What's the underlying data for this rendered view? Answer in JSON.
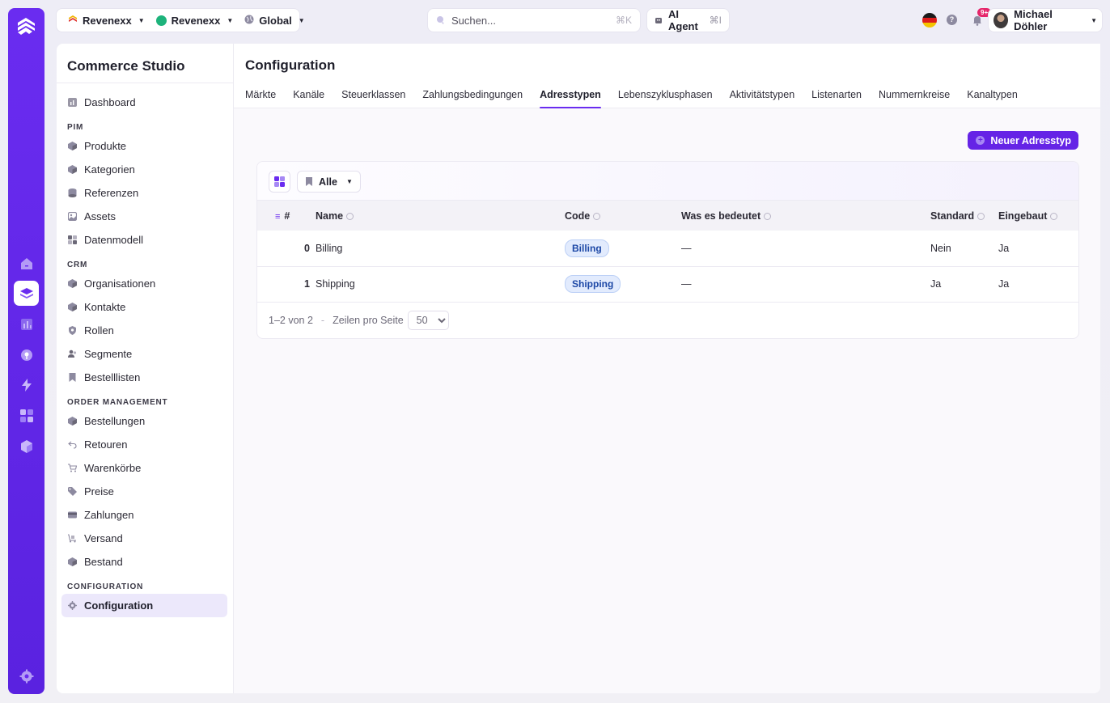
{
  "topbar": {
    "context": [
      {
        "label": "Revenexx",
        "icon": "shop-logo-icon",
        "color": "#f0b400"
      },
      {
        "label": "Revenexx",
        "icon": "green-dot-icon",
        "color": "#1db37b"
      },
      {
        "label": "Global",
        "icon": "globe-icon",
        "color": "#6b6877"
      }
    ],
    "search_placeholder": "Suchen...",
    "search_shortcut": "⌘K",
    "agent_label": "AI Agent",
    "agent_shortcut": "⌘I",
    "help_label": "?",
    "notif_badge": "9+",
    "user_name": "Michael Döhler"
  },
  "sidebar": {
    "brand": "Commerce Studio",
    "top_items": [
      {
        "label": "Dashboard",
        "icon": "chart-icon"
      }
    ],
    "sections": [
      {
        "title": "PIM",
        "items": [
          {
            "label": "Produkte",
            "icon": "cube-icon"
          },
          {
            "label": "Kategorien",
            "icon": "cube-icon"
          },
          {
            "label": "Referenzen",
            "icon": "database-icon"
          },
          {
            "label": "Assets",
            "icon": "image-icon"
          },
          {
            "label": "Datenmodell",
            "icon": "grid-icon"
          }
        ]
      },
      {
        "title": "CRM",
        "items": [
          {
            "label": "Organisationen",
            "icon": "cube-icon"
          },
          {
            "label": "Kontakte",
            "icon": "cube-icon"
          },
          {
            "label": "Rollen",
            "icon": "shield-icon"
          },
          {
            "label": "Segmente",
            "icon": "users-icon"
          },
          {
            "label": "Bestelllisten",
            "icon": "bookmark-icon"
          }
        ]
      },
      {
        "title": "ORDER MANAGEMENT",
        "items": [
          {
            "label": "Bestellungen",
            "icon": "cube-icon"
          },
          {
            "label": "Retouren",
            "icon": "return-icon"
          },
          {
            "label": "Warenkörbe",
            "icon": "cart-icon"
          },
          {
            "label": "Preise",
            "icon": "tag-icon"
          },
          {
            "label": "Zahlungen",
            "icon": "card-icon"
          },
          {
            "label": "Versand",
            "icon": "truck-icon"
          },
          {
            "label": "Bestand",
            "icon": "cube-icon"
          }
        ]
      },
      {
        "title": "CONFIGURATION",
        "items": [
          {
            "label": "Configuration",
            "icon": "gear-icon",
            "active": true
          }
        ]
      }
    ]
  },
  "main": {
    "title": "Configuration",
    "tabs": [
      "Märkte",
      "Kanäle",
      "Steuerklassen",
      "Zahlungsbedingungen",
      "Adresstypen",
      "Lebenszyklusphasen",
      "Aktivitätstypen",
      "Listenarten",
      "Nummernkreise",
      "Kanaltypen"
    ],
    "active_tab": "Adresstypen",
    "new_button": "Neuer Adresstyp",
    "filter_label": "Alle",
    "columns": [
      "#",
      "Name",
      "Code",
      "Was es bedeutet",
      "Standard",
      "Eingebaut"
    ],
    "rows": [
      {
        "index": "0",
        "name": "Billing",
        "code": "Billing",
        "meaning": "—",
        "standard": "Nein",
        "builtin": "Ja"
      },
      {
        "index": "1",
        "name": "Shipping",
        "code": "Shipping",
        "meaning": "—",
        "standard": "Ja",
        "builtin": "Ja"
      }
    ],
    "pagination": {
      "range": "1–2 von 2",
      "separator": "-",
      "rows_label": "Zeilen pro Seite",
      "page_size": "50"
    }
  },
  "colors": {
    "accent": "#6a2cf0",
    "code_badge_bg": "#e2ebfd",
    "code_badge_text": "#1d48a6"
  }
}
